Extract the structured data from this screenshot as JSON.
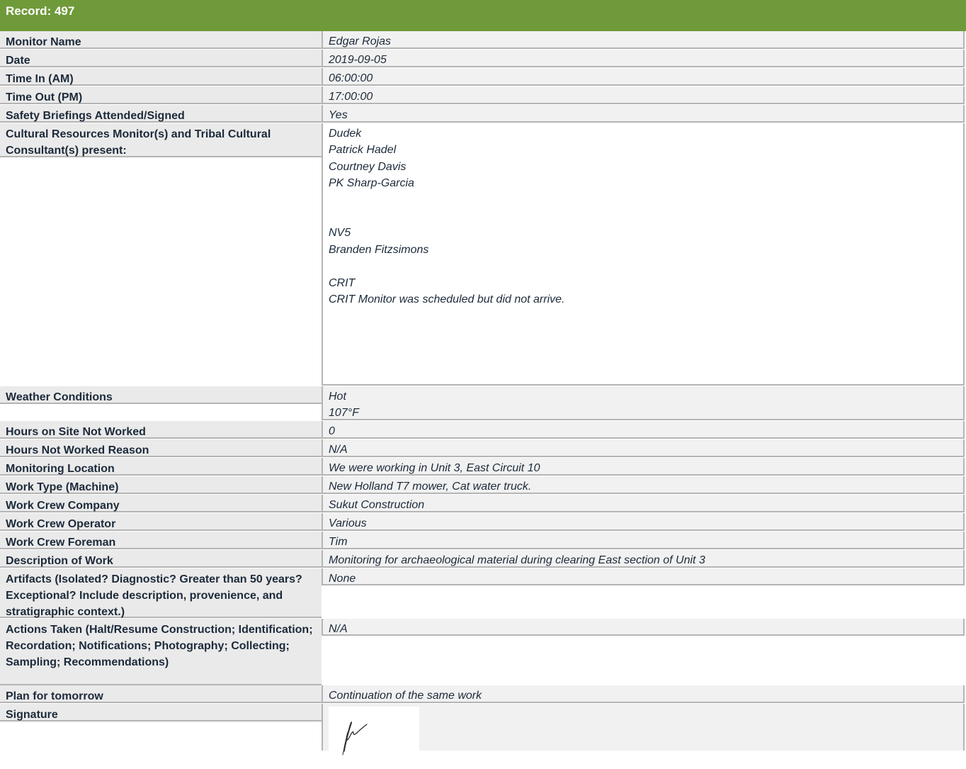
{
  "record_title": "Record: 497",
  "rows": [
    {
      "label": "Monitor Name",
      "value": [
        "Edgar Rojas"
      ]
    },
    {
      "label": "Date",
      "value": [
        "2019-09-05"
      ]
    },
    {
      "label": "Time In (AM)",
      "value": [
        "06:00:00"
      ]
    },
    {
      "label": "Time Out (PM)",
      "value": [
        "17:00:00"
      ]
    },
    {
      "label": "Safety Briefings Attended/Signed",
      "value": [
        "Yes"
      ]
    },
    {
      "label": "Cultural Resources Monitor(s) and Tribal Cultural Consultant(s) present:",
      "value": [
        "Dudek",
        "Patrick Hadel",
        "Courtney Davis",
        "PK Sharp-Garcia",
        "",
        "",
        "NV5",
        "Branden Fitzsimons",
        "",
        "CRIT",
        "CRIT Monitor was scheduled but did not arrive."
      ]
    },
    {
      "label": "Weather Conditions",
      "value": [
        "Hot",
        "107°F"
      ]
    },
    {
      "label": "Hours on Site Not Worked",
      "value": [
        "0"
      ]
    },
    {
      "label": "Hours Not Worked Reason",
      "value": [
        "N/A"
      ]
    },
    {
      "label": "Monitoring Location",
      "value": [
        "We were working in Unit 3, East Circuit 10"
      ]
    },
    {
      "label": "Work Type (Machine)",
      "value": [
        "New Holland T7 mower, Cat water truck."
      ]
    },
    {
      "label": "Work Crew Company",
      "value": [
        "Sukut Construction"
      ]
    },
    {
      "label": "Work Crew Operator",
      "value": [
        "Various"
      ]
    },
    {
      "label": "Work Crew Foreman",
      "value": [
        "Tim"
      ]
    },
    {
      "label": "Description of Work",
      "value": [
        "Monitoring for archaeological material during clearing East section of Unit 3"
      ]
    },
    {
      "label": "Artifacts (Isolated? Diagnostic? Greater than 50 years? Exceptional?  Include description, provenience, and stratigraphic context.)",
      "value": [
        "None"
      ]
    },
    {
      "label": "Actions Taken (Halt/Resume Construction; Identification; Recordation; Notifications; Photography; Collecting; Sampling; Recommendations)",
      "value": [
        "N/A"
      ]
    },
    {
      "label": "Plan for tomorrow",
      "value": [
        "Continuation of the same work"
      ]
    },
    {
      "label": "Signature",
      "value": []
    }
  ]
}
